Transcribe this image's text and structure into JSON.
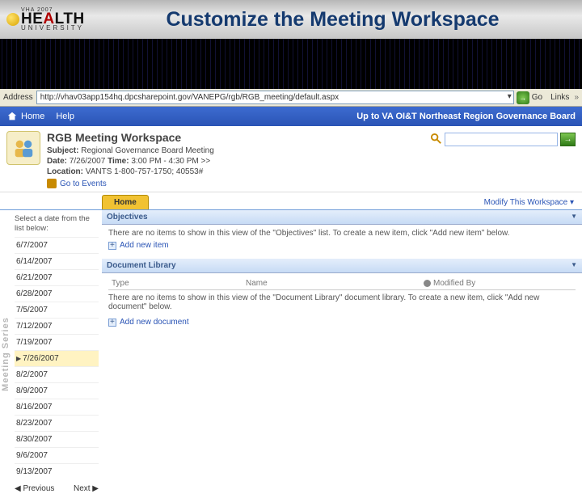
{
  "banner": {
    "logo_line1": "VHA 2007",
    "logo_main": "HEALTH",
    "logo_sub": "UNIVERSITY",
    "title": "Customize the Meeting Workspace"
  },
  "addressbar": {
    "label": "Address",
    "url": "http://vhav03app154hq.dpcsharepoint.gov/VANEPG/rgb/RGB_meeting/default.aspx",
    "go_text": "Go",
    "links_label": "Links"
  },
  "topnav": {
    "home": "Home",
    "help": "Help",
    "uplink": "Up to VA OI&T Northeast Region Governance Board"
  },
  "workspace": {
    "title": "RGB Meeting Workspace",
    "subject_label": "Subject:",
    "subject": "Regional Governance Board Meeting",
    "date_label": "Date:",
    "date": "7/26/2007",
    "time_label": "Time:",
    "time": "3:00 PM - 4:30 PM >>",
    "location_label": "Location:",
    "location": "VANTS 1-800-757-1750; 40553#",
    "events_link": "Go to Events",
    "search_placeholder": ""
  },
  "tabs": {
    "home": "Home",
    "modify": "Modify This Workspace ▾"
  },
  "sidebar": {
    "strip_label": "Meeting Series",
    "hint": "Select a date from the list below:",
    "dates": [
      "6/7/2007",
      "6/14/2007",
      "6/21/2007",
      "6/28/2007",
      "7/5/2007",
      "7/12/2007",
      "7/19/2007",
      "7/26/2007",
      "8/2/2007",
      "8/9/2007",
      "8/16/2007",
      "8/23/2007",
      "8/30/2007",
      "9/6/2007",
      "9/13/2007"
    ],
    "selected_index": 7,
    "prev": "◀ Previous",
    "next": "Next ▶"
  },
  "webparts": {
    "objectives": {
      "title": "Objectives",
      "empty": "There are no items to show in this view of the \"Objectives\" list. To create a new item, click \"Add new item\" below.",
      "addlink": "Add new item"
    },
    "doclib": {
      "title": "Document Library",
      "col_type": "Type",
      "col_name": "Name",
      "col_modifiedby": "Modified By",
      "empty": "There are no items to show in this view of the \"Document Library\" document library. To create a new item, click \"Add new document\" below.",
      "addlink": "Add new document"
    }
  }
}
